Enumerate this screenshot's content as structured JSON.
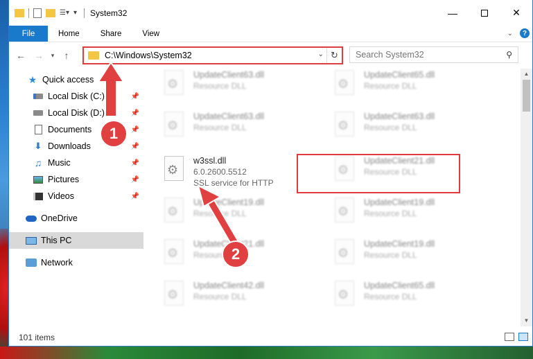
{
  "window": {
    "title": "System32"
  },
  "ribbon": {
    "tabs": [
      "File",
      "Home",
      "Share",
      "View"
    ]
  },
  "address": {
    "path": "C:\\Windows\\System32"
  },
  "search": {
    "placeholder": "Search System32"
  },
  "sidebar": {
    "items": [
      {
        "label": "Quick access",
        "icon": "star-icon"
      },
      {
        "label": "Local Disk (C:)",
        "icon": "drive-icon",
        "pinned": true
      },
      {
        "label": "Local Disk (D:)",
        "icon": "drive-icon",
        "pinned": true
      },
      {
        "label": "Documents",
        "icon": "document-icon",
        "pinned": true
      },
      {
        "label": "Downloads",
        "icon": "download-icon",
        "pinned": true
      },
      {
        "label": "Music",
        "icon": "music-icon",
        "pinned": true
      },
      {
        "label": "Pictures",
        "icon": "pictures-icon",
        "pinned": true
      },
      {
        "label": "Videos",
        "icon": "video-icon",
        "pinned": true
      },
      {
        "label": "OneDrive",
        "icon": "cloud-icon"
      },
      {
        "label": "This PC",
        "icon": "computer-icon",
        "selected": true
      },
      {
        "label": "Network",
        "icon": "network-icon"
      }
    ]
  },
  "files": [
    {
      "name": "UpdateClient63.dll",
      "desc": "Resource DLL"
    },
    {
      "name": "UpdateClient65.dll",
      "desc": "Resource DLL"
    },
    {
      "name": "UpdateClient63.dll",
      "desc": "Resource DLL"
    },
    {
      "name": "UpdateClient63.dll",
      "desc": "Resource DLL"
    },
    {
      "name": "w3ssl.dll",
      "version": "6.0.2600.5512",
      "desc": "SSL service for HTTP",
      "highlighted": true
    },
    {
      "name": "UpdateClient21.dll",
      "desc": "Resource DLL"
    },
    {
      "name": "UpdateClient19.dll",
      "desc": "Resource DLL"
    },
    {
      "name": "UpdateClient19.dll",
      "desc": "Resource DLL"
    },
    {
      "name": "UpdateClient21.dll",
      "desc": "Resource DLL"
    },
    {
      "name": "UpdateClient19.dll",
      "desc": "Resource DLL"
    },
    {
      "name": "UpdateClient42.dll",
      "desc": "Resource DLL"
    },
    {
      "name": "UpdateClient65.dll",
      "desc": "Resource DLL"
    }
  ],
  "status": {
    "item_count": "101 items"
  },
  "callouts": [
    "1",
    "2"
  ],
  "colors": {
    "accent": "#1979ca",
    "highlight": "#e23b3b"
  }
}
